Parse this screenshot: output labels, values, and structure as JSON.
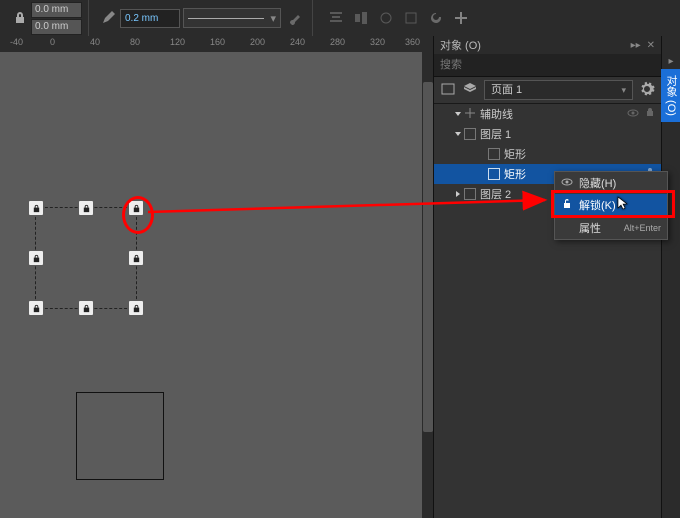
{
  "toolbar": {
    "w": "0.0 mm",
    "h": "0.0 mm",
    "stroke_width": "0.2 mm"
  },
  "ruler": {
    "ticks": [
      "-40",
      "0",
      "40",
      "80",
      "120",
      "160",
      "200",
      "240",
      "280",
      "320",
      "360"
    ]
  },
  "panel": {
    "title": "对象 (O)",
    "search_placeholder": "搜索",
    "page_label": "页面 1",
    "side_tab": "对象 (O)"
  },
  "tree": {
    "guides": "辅助线",
    "layer1": "图层 1",
    "rect1": "矩形",
    "rect2": "矩形",
    "layer2": "图层 2"
  },
  "ctx": {
    "hide": "隐藏(H)",
    "unlock": "解锁(K)",
    "props": "属性",
    "props_sc": "Alt+Enter"
  }
}
